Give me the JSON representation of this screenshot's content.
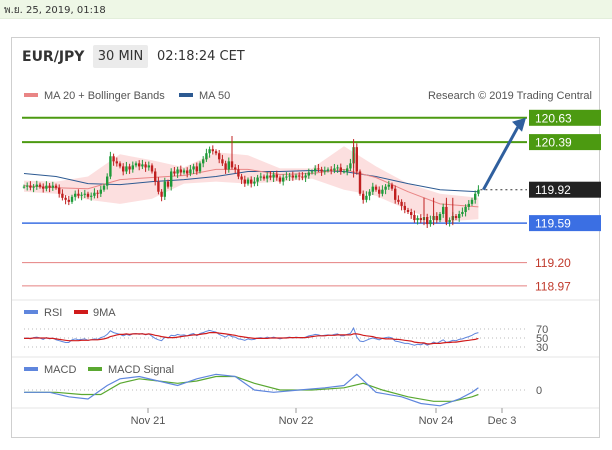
{
  "date_bar": "พ.ย. 25, 2019, 01:18",
  "header": {
    "pair": "EUR/JPY",
    "timeframe": "30 MIN",
    "time": "02:18:24 CET"
  },
  "colors": {
    "resistance": "#4c9a11",
    "support": "#3b6fe3",
    "target": "#e58080",
    "price_tag": "#222222",
    "arrow": "#2f5f9e",
    "ma20": "#e98585",
    "ma50": "#2d5a92",
    "bands": "#fcd9d9",
    "up": "#1f9a3a",
    "down": "#c02020",
    "rsi": "#5f86dd",
    "rsi_ma": "#d01b1b",
    "macd": "#5f86dd",
    "macd_signal": "#5aa831"
  },
  "chart_data": {
    "type": "candlestick",
    "instrument": "EUR/JPY",
    "interval": "30 MIN",
    "attribution": "Research © 2019 Trading Central",
    "legend": [
      {
        "name": "MA 20 + Bollinger Bands",
        "color": "#e98585"
      },
      {
        "name": "MA 50",
        "color": "#2d5a92"
      }
    ],
    "x_labels": [
      "Nov 21",
      "Nov 22",
      "Nov 24",
      "Dec 3"
    ],
    "y_range": [
      118.9,
      120.7
    ],
    "close": [
      119.95,
      119.96,
      119.94,
      119.95,
      119.97,
      119.95,
      119.93,
      119.96,
      119.94,
      119.96,
      119.94,
      119.88,
      119.84,
      119.82,
      119.8,
      119.85,
      119.88,
      119.86,
      119.87,
      119.88,
      119.85,
      119.86,
      119.89,
      119.88,
      119.92,
      119.96,
      120.05,
      120.25,
      120.2,
      120.18,
      120.15,
      120.1,
      120.15,
      120.12,
      120.16,
      120.18,
      120.15,
      120.17,
      120.14,
      120.16,
      120.1,
      120.0,
      119.9,
      119.85,
      120.0,
      119.95,
      120.1,
      120.08,
      120.12,
      120.09,
      120.11,
      120.08,
      120.12,
      120.15,
      120.1,
      120.18,
      120.22,
      120.28,
      120.32,
      120.3,
      120.28,
      120.22,
      120.18,
      120.12,
      120.2,
      120.14,
      120.12,
      120.05,
      120.02,
      119.98,
      120.02,
      119.98,
      120.0,
      120.04,
      120.05,
      120.03,
      120.06,
      120.04,
      120.07,
      120.04,
      120.0,
      120.04,
      120.05,
      120.06,
      120.04,
      120.06,
      120.05,
      120.04,
      120.06,
      120.09,
      120.1,
      120.13,
      120.12,
      120.1,
      120.11,
      120.12,
      120.11,
      120.13,
      120.14,
      120.1,
      120.1,
      120.13,
      120.18,
      120.34,
      120.1,
      119.88,
      119.82,
      119.86,
      119.9,
      119.95,
      119.92,
      119.88,
      119.92,
      119.95,
      119.97,
      119.93,
      119.82,
      119.8,
      119.76,
      119.72,
      119.7,
      119.67,
      119.62,
      119.64,
      119.62,
      119.65,
      119.58,
      119.62,
      119.66,
      119.62,
      119.68,
      119.75,
      119.6,
      119.62,
      119.66,
      119.64,
      119.68,
      119.7,
      119.75,
      119.78,
      119.82,
      119.88,
      119.92
    ],
    "spike_index": 103,
    "low_wicks": [
      125,
      128,
      132,
      134
    ],
    "ma20": [
      [
        0,
        119.96
      ],
      [
        10,
        119.94
      ],
      [
        20,
        119.93
      ],
      [
        30,
        120.02
      ],
      [
        40,
        120.04
      ],
      [
        50,
        120.06
      ],
      [
        60,
        120.12
      ],
      [
        70,
        120.12
      ],
      [
        80,
        120.07
      ],
      [
        90,
        120.08
      ],
      [
        100,
        120.12
      ],
      [
        110,
        120.04
      ],
      [
        120,
        119.9
      ],
      [
        130,
        119.78
      ],
      [
        142,
        119.75
      ]
    ],
    "ma50": [
      [
        0,
        120.08
      ],
      [
        10,
        120.05
      ],
      [
        20,
        119.98
      ],
      [
        30,
        119.97
      ],
      [
        40,
        120.0
      ],
      [
        50,
        120.02
      ],
      [
        60,
        120.05
      ],
      [
        70,
        120.1
      ],
      [
        80,
        120.1
      ],
      [
        90,
        120.11
      ],
      [
        100,
        120.1
      ],
      [
        110,
        120.05
      ],
      [
        120,
        119.98
      ],
      [
        130,
        119.92
      ],
      [
        142,
        119.9
      ]
    ],
    "bb_upper": [
      [
        0,
        120.01
      ],
      [
        10,
        120.0
      ],
      [
        20,
        120.05
      ],
      [
        30,
        120.27
      ],
      [
        40,
        120.21
      ],
      [
        50,
        120.14
      ],
      [
        60,
        120.29
      ],
      [
        70,
        120.26
      ],
      [
        80,
        120.13
      ],
      [
        90,
        120.13
      ],
      [
        100,
        120.35
      ],
      [
        110,
        120.15
      ],
      [
        120,
        119.98
      ],
      [
        130,
        119.88
      ],
      [
        142,
        119.84
      ]
    ],
    "bb_lower": [
      [
        0,
        119.9
      ],
      [
        10,
        119.88
      ],
      [
        20,
        119.82
      ],
      [
        30,
        119.78
      ],
      [
        40,
        119.83
      ],
      [
        50,
        119.98
      ],
      [
        60,
        120.0
      ],
      [
        70,
        119.98
      ],
      [
        80,
        120.0
      ],
      [
        90,
        120.03
      ],
      [
        100,
        119.92
      ],
      [
        110,
        119.86
      ],
      [
        120,
        119.72
      ],
      [
        130,
        119.6
      ],
      [
        142,
        119.63
      ]
    ],
    "levels": [
      {
        "value": "120.63",
        "kind": "resistance"
      },
      {
        "value": "120.39",
        "kind": "resistance"
      },
      {
        "value": "119.92",
        "kind": "price"
      },
      {
        "value": "119.59",
        "kind": "support"
      },
      {
        "value": "119.20",
        "kind": "target"
      },
      {
        "value": "118.97",
        "kind": "target"
      }
    ],
    "forecast_arrow": {
      "from": 119.92,
      "to": 120.63
    },
    "rsi": {
      "legend": [
        {
          "name": "RSI",
          "color": "#5f86dd"
        },
        {
          "name": "9MA",
          "color": "#d01b1b"
        }
      ],
      "levels": [
        "70",
        "50",
        "30"
      ],
      "values": [
        49,
        50,
        48,
        51,
        52,
        50,
        47,
        51,
        48,
        50,
        46,
        44,
        42,
        40,
        40,
        46,
        48,
        46,
        47,
        48,
        45,
        46,
        48,
        47,
        51,
        53,
        58,
        66,
        62,
        60,
        58,
        55,
        58,
        56,
        59,
        60,
        58,
        60,
        57,
        59,
        54,
        49,
        46,
        44,
        52,
        50,
        56,
        55,
        58,
        56,
        57,
        55,
        58,
        60,
        55,
        60,
        62,
        65,
        67,
        65,
        63,
        58,
        55,
        52,
        57,
        53,
        52,
        48,
        47,
        45,
        48,
        46,
        47,
        50,
        51,
        49,
        52,
        50,
        52,
        50,
        48,
        50,
        51,
        52,
        50,
        52,
        51,
        50,
        52,
        55,
        56,
        58,
        57,
        55,
        56,
        57,
        56,
        58,
        59,
        55,
        55,
        58,
        60,
        72,
        52,
        43,
        42,
        45,
        48,
        50,
        48,
        46,
        49,
        51,
        52,
        50,
        43,
        42,
        40,
        38,
        38,
        36,
        34,
        36,
        35,
        38,
        34,
        37,
        41,
        38,
        42,
        46,
        40,
        42,
        45,
        44,
        47,
        48,
        51,
        53,
        56,
        60,
        62
      ],
      "ma": [
        49,
        49,
        49,
        50,
        50,
        50,
        50,
        50,
        49,
        49,
        48,
        47,
        46,
        45,
        44,
        44,
        44,
        44,
        45,
        45,
        45,
        46,
        46,
        46,
        47,
        48,
        50,
        53,
        55,
        57,
        58,
        58,
        59,
        58,
        59,
        59,
        59,
        59,
        58,
        59,
        58,
        56,
        55,
        53,
        52,
        51,
        51,
        51,
        52,
        53,
        54,
        55,
        56,
        57,
        57,
        58,
        59,
        60,
        62,
        62,
        62,
        61,
        60,
        59,
        58,
        57,
        56,
        54,
        53,
        52,
        51,
        50,
        49,
        49,
        49,
        49,
        49,
        50,
        50,
        50,
        50,
        50,
        50,
        51,
        51,
        51,
        51,
        51,
        51,
        52,
        53,
        54,
        55,
        55,
        55,
        56,
        56,
        56,
        57,
        57,
        57,
        57,
        57,
        59,
        59,
        58,
        56,
        55,
        54,
        53,
        51,
        50,
        49,
        48,
        48,
        48,
        47,
        47,
        46,
        45,
        44,
        43,
        41,
        40,
        39,
        39,
        37,
        37,
        38,
        38,
        38,
        39,
        40,
        40,
        41,
        41,
        42,
        43,
        44,
        45,
        46,
        47,
        49
      ]
    },
    "macd": {
      "legend": [
        {
          "name": "MACD",
          "color": "#5f86dd"
        },
        {
          "name": "MACD Signal",
          "color": "#5aa831"
        }
      ],
      "zero_label": "0",
      "range": [
        -0.12,
        0.12
      ],
      "line": [
        [
          0,
          -0.01
        ],
        [
          8,
          -0.01
        ],
        [
          14,
          -0.03
        ],
        [
          20,
          -0.04
        ],
        [
          26,
          0.02
        ],
        [
          30,
          0.05
        ],
        [
          36,
          0.06
        ],
        [
          42,
          0.04
        ],
        [
          48,
          0.02
        ],
        [
          54,
          0.05
        ],
        [
          60,
          0.07
        ],
        [
          66,
          0.06
        ],
        [
          72,
          0.0
        ],
        [
          78,
          -0.01
        ],
        [
          86,
          0.0
        ],
        [
          94,
          0.01
        ],
        [
          100,
          0.02
        ],
        [
          104,
          0.07
        ],
        [
          110,
          -0.01
        ],
        [
          118,
          -0.03
        ],
        [
          124,
          -0.06
        ],
        [
          130,
          -0.07
        ],
        [
          136,
          -0.04
        ],
        [
          140,
          -0.01
        ],
        [
          142,
          0.01
        ]
      ],
      "signal": [
        [
          0,
          -0.01
        ],
        [
          10,
          -0.01
        ],
        [
          18,
          -0.02
        ],
        [
          24,
          -0.02
        ],
        [
          30,
          0.03
        ],
        [
          36,
          0.05
        ],
        [
          42,
          0.04
        ],
        [
          48,
          0.03
        ],
        [
          54,
          0.04
        ],
        [
          60,
          0.06
        ],
        [
          66,
          0.06
        ],
        [
          72,
          0.03
        ],
        [
          80,
          0.0
        ],
        [
          90,
          0.0
        ],
        [
          100,
          0.01
        ],
        [
          106,
          0.03
        ],
        [
          112,
          0.0
        ],
        [
          120,
          -0.03
        ],
        [
          128,
          -0.05
        ],
        [
          134,
          -0.05
        ],
        [
          140,
          -0.03
        ],
        [
          142,
          -0.02
        ]
      ]
    }
  }
}
